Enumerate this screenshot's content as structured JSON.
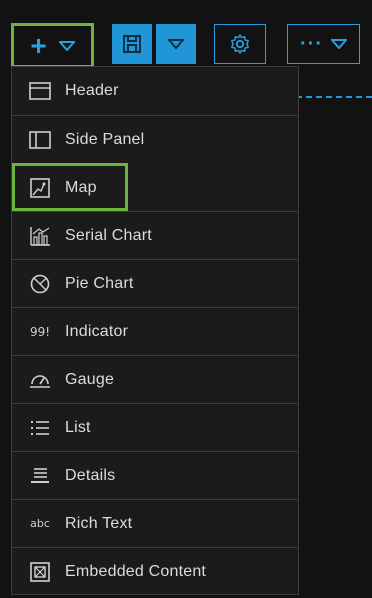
{
  "toolbar": {
    "add_glyph": "+",
    "more_glyph": "···"
  },
  "colors": {
    "highlight": "#6db33f",
    "accent": "#2196d6"
  },
  "menu": {
    "items": [
      {
        "label": "Header",
        "icon": "header-icon"
      },
      {
        "label": "Side Panel",
        "icon": "side-panel-icon"
      },
      {
        "label": "Map",
        "icon": "map-icon",
        "selected": true
      },
      {
        "label": "Serial Chart",
        "icon": "serial-chart-icon"
      },
      {
        "label": "Pie Chart",
        "icon": "pie-chart-icon"
      },
      {
        "label": "Indicator",
        "icon": "indicator-icon",
        "icon_text": "99!"
      },
      {
        "label": "Gauge",
        "icon": "gauge-icon"
      },
      {
        "label": "List",
        "icon": "list-icon"
      },
      {
        "label": "Details",
        "icon": "details-icon"
      },
      {
        "label": "Rich Text",
        "icon": "rich-text-icon",
        "icon_text": "abc"
      },
      {
        "label": "Embedded Content",
        "icon": "embedded-content-icon"
      }
    ]
  }
}
